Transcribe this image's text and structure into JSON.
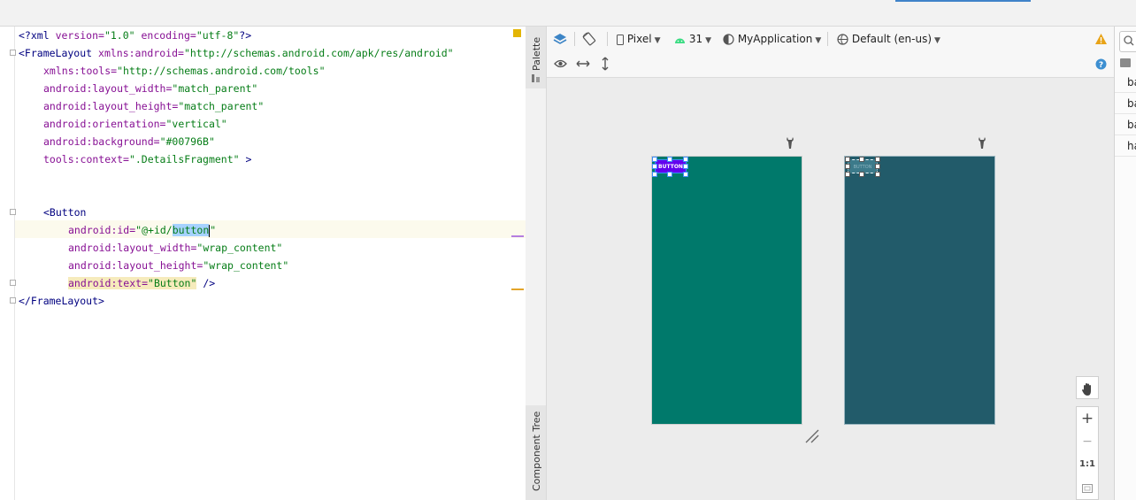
{
  "editor": {
    "lines": [
      "<?xml version=\"1.0\" encoding=\"utf-8\"?>",
      "<FrameLayout xmlns:android=\"http://schemas.android.com/apk/res/android\"",
      "    xmlns:tools=\"http://schemas.android.com/tools\"",
      "    android:layout_width=\"match_parent\"",
      "    android:layout_height=\"match_parent\"",
      "    android:orientation=\"vertical\"",
      "    android:background=\"#00796B\"",
      "    tools:context=\".DetailsFragment\" >",
      "",
      "",
      "    <Button",
      "        android:id=\"@+id/button\"",
      "        android:layout_width=\"wrap_content\"",
      "        android:layout_height=\"wrap_content\"",
      "        android:text=\"Button\" />",
      "</FrameLayout>"
    ],
    "tokens": {
      "xml_decl_open": "<?",
      "xml_kw": "xml",
      "version_attr": " version=",
      "version_val": "\"1.0\"",
      "encoding_attr": " encoding=",
      "encoding_val": "\"utf-8\"",
      "xml_decl_close": "?>",
      "frame_open": "<FrameLayout",
      "xmlns_android_attr": " xmlns:android=",
      "xmlns_android_val": "\"http://schemas.android.com/apk/res/android\"",
      "xmlns_tools_attr": "xmlns:tools=",
      "xmlns_tools_val": "\"http://schemas.android.com/tools\"",
      "lw_attr": "android:layout_width=",
      "lw_val": "\"match_parent\"",
      "lh_attr": "android:layout_height=",
      "lh_val": "\"match_parent\"",
      "orient_attr": "android:orientation=",
      "orient_val": "\"vertical\"",
      "bg_attr": "android:background=",
      "bg_val": "\"#00796B\"",
      "ctx_attr": "tools:context=",
      "ctx_val": "\".DetailsFragment\"",
      "ctx_close": " >",
      "button_open": "<Button",
      "id_attr": "android:id=",
      "id_val_a": "\"@+id/",
      "id_val_sel": "button",
      "id_val_b": "\"",
      "bw_attr": "android:layout_width=",
      "bw_val": "\"wrap_content\"",
      "bh_attr": "android:layout_height=",
      "bh_val": "\"wrap_content\"",
      "text_attr": "android:text=",
      "text_val": "\"Button\"",
      "button_close": " />",
      "frame_close": "</FrameLayout>"
    }
  },
  "sidetabs": {
    "palette": "Palette",
    "component_tree": "Component Tree"
  },
  "toolbar": {
    "device": "Pixel",
    "api": "31",
    "theme": "MyApplication",
    "locale": "Default (en-us)"
  },
  "preview": {
    "button_text": "BUTTON",
    "button_text_blueprint": "BUTTON",
    "background_color": "#00796B",
    "blueprint_color": "#225B6A",
    "button_color": "#6200EE"
  },
  "zoom": {
    "plus": "+",
    "minus": "−",
    "one_to_one": "1:1"
  },
  "attributes": {
    "rows": [
      "ba",
      "ba",
      "ba",
      "ha"
    ]
  },
  "icons": [
    "layers-icon",
    "rotate-icon",
    "phone-icon",
    "android-icon",
    "theme-icon",
    "globe-icon",
    "warning-icon",
    "eye-icon",
    "horizontal-arrows-icon",
    "vertical-arrows-icon",
    "help-icon",
    "wrench-icon",
    "hand-icon",
    "search-icon"
  ]
}
